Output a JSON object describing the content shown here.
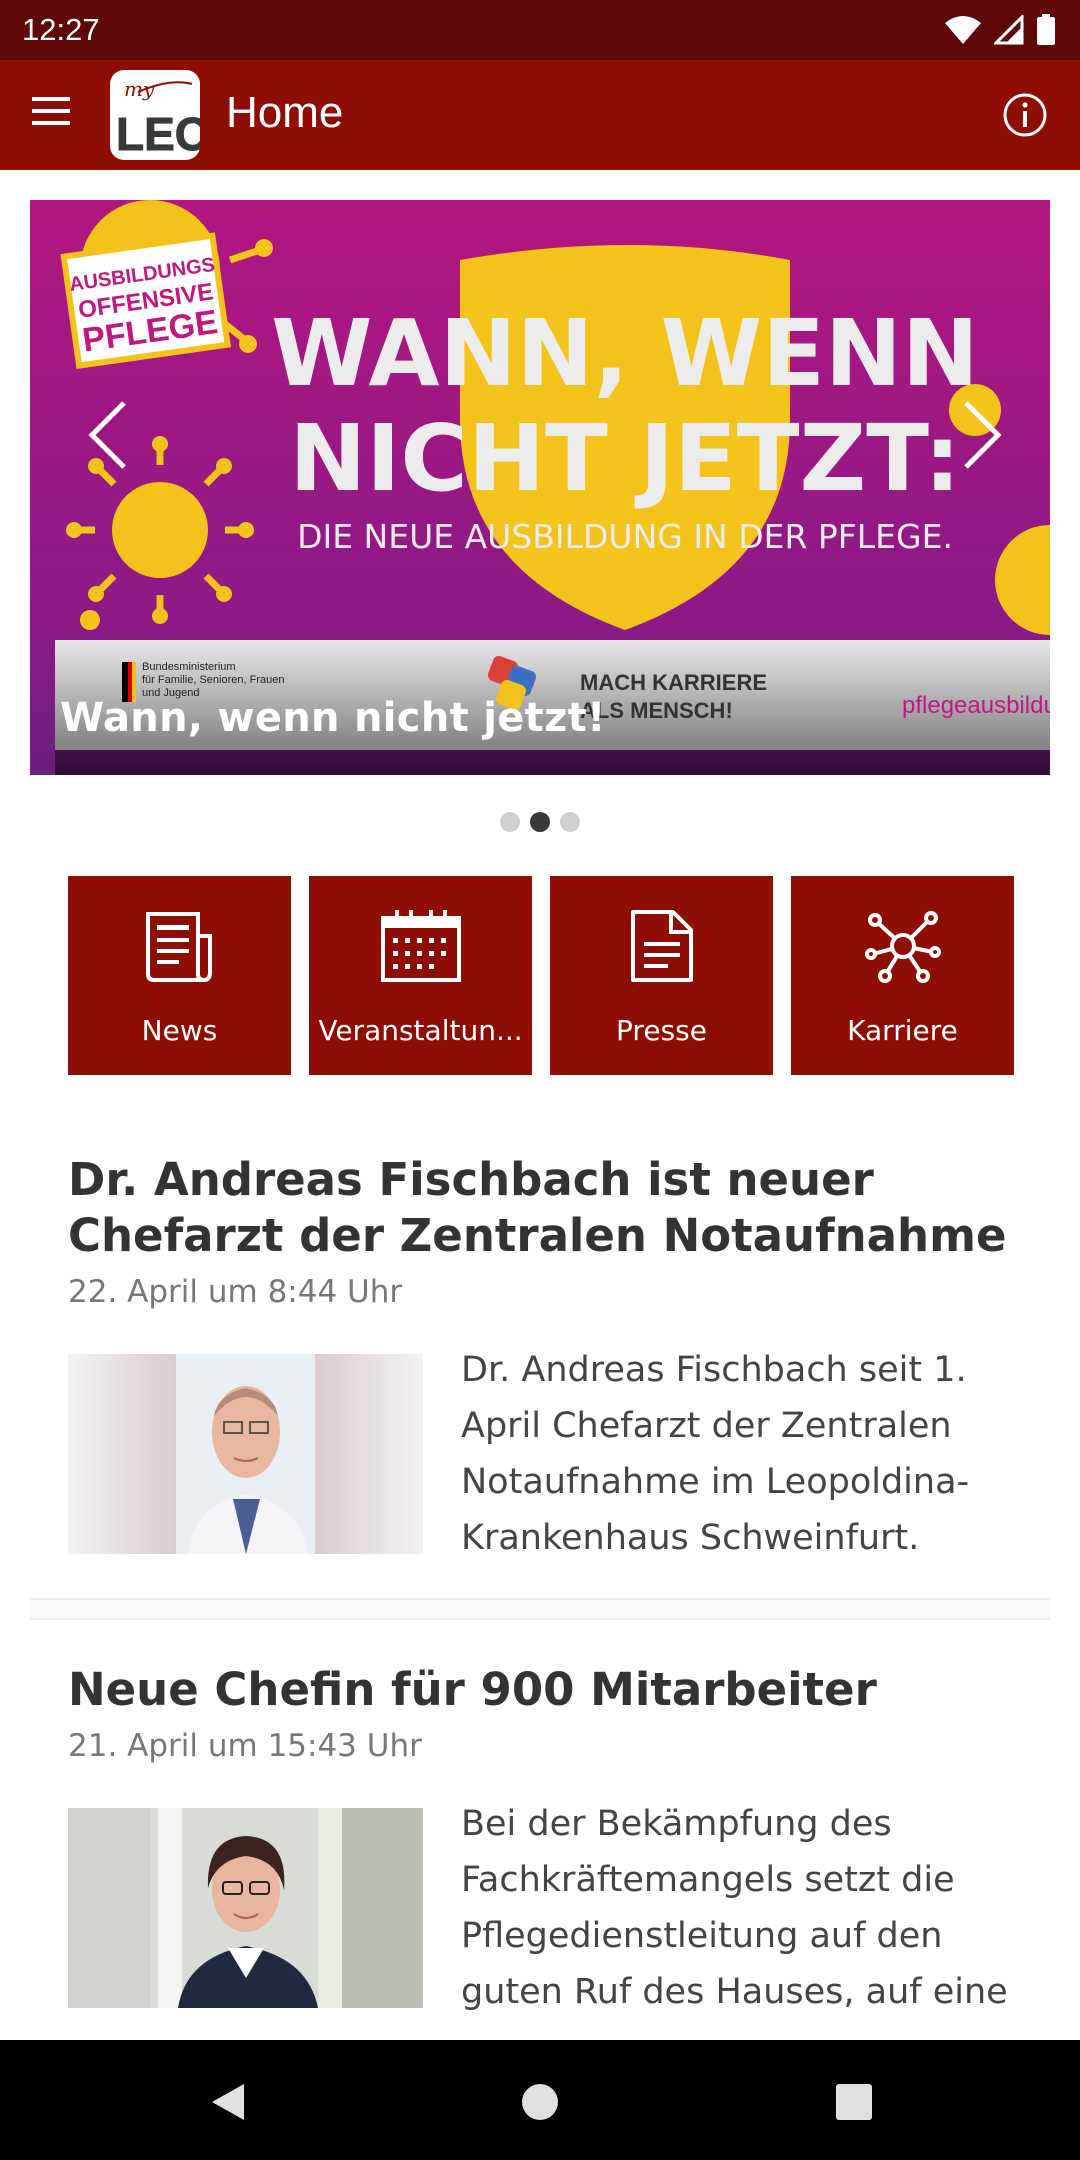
{
  "status_bar": {
    "time": "12:27"
  },
  "app_bar": {
    "title": "Home",
    "logo_text": "LEO",
    "logo_script": "my"
  },
  "banner": {
    "caption": "Wann, wenn nicht jetzt!",
    "badge": [
      "AUSBILDUNGS",
      "OFFENSIVE",
      "PFLEGE"
    ],
    "headline_1": "WANN, WENN",
    "headline_2": "NICHT JETZT:",
    "subline": "DIE NEUE AUSBILDUNG IN DER PFLEGE.",
    "footer_ministry": [
      "Bundesministerium",
      "für Familie, Senioren, Frauen",
      "und Jugend"
    ],
    "footer_slogan": [
      "MACH KARRIERE",
      "ALS MENSCH!"
    ],
    "footer_url": "pflegeausbildung",
    "slide_index": 2,
    "slide_count": 3
  },
  "tiles": [
    {
      "label": "News",
      "icon": "newspaper-icon"
    },
    {
      "label": "Veranstaltun...",
      "icon": "calendar-icon"
    },
    {
      "label": "Presse",
      "icon": "document-icon"
    },
    {
      "label": "Karriere",
      "icon": "network-icon"
    }
  ],
  "articles": [
    {
      "title": "Dr. Andreas Fischbach ist neuer Chefarzt der Zentralen Notaufnahme",
      "date": "22. April um 8:44 Uhr",
      "excerpt": "Dr. Andreas Fischbach seit 1. April Chefarzt der Zentralen Notaufnahme im Leopoldina-Krankenhaus Schweinfurt."
    },
    {
      "title": "Neue Chefin für 900 Mitarbeiter",
      "date": "21. April um 15:43 Uhr",
      "excerpt": "Bei der Bekämpfung des Fachkräftemangels setzt die Pflegedienstleitung auf den guten Ruf des Hauses, auf eine"
    }
  ],
  "colors": {
    "primary": "#8e0d04",
    "status_bar": "#5e0808",
    "banner_bg": "#b0187d",
    "accent_yellow": "#f3c21b"
  }
}
